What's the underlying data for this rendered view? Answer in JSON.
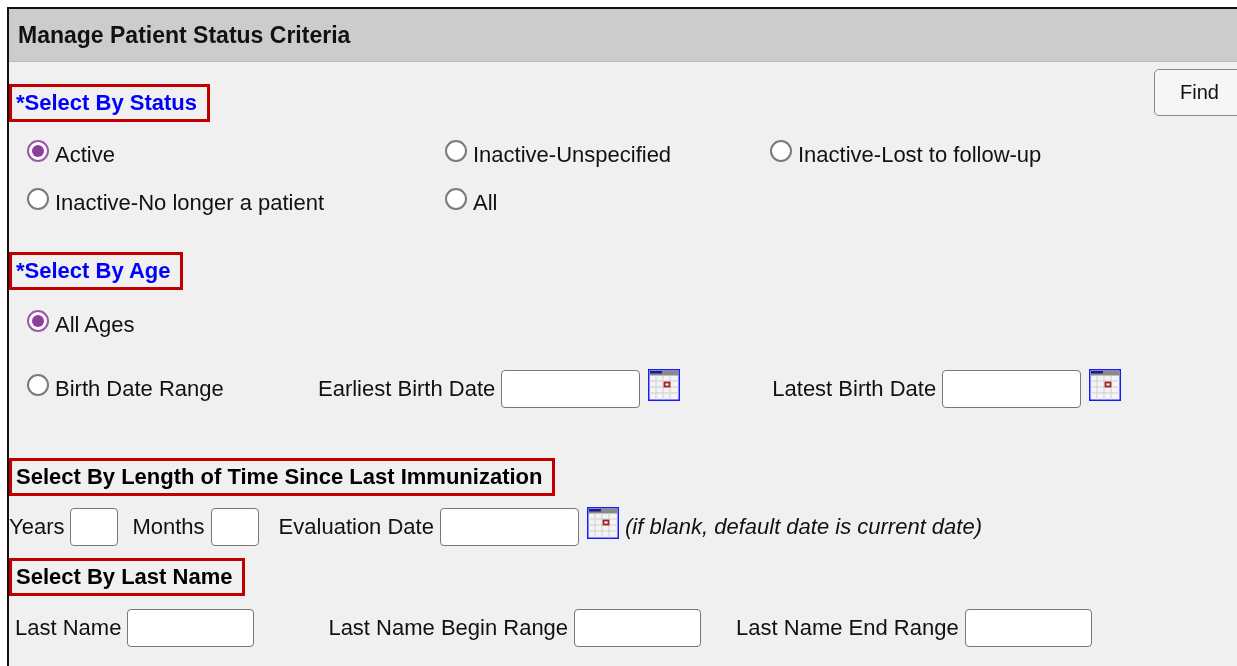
{
  "panel": {
    "title": "Manage Patient Status Criteria",
    "find_button": "Find"
  },
  "status": {
    "heading": "*Select By Status",
    "required": true,
    "highlighted": true,
    "options": [
      {
        "label": "Active",
        "selected": true
      },
      {
        "label": "Inactive-Unspecified",
        "selected": false
      },
      {
        "label": "Inactive-Lost to follow-up",
        "selected": false
      },
      {
        "label": "Inactive-No longer a patient",
        "selected": false
      },
      {
        "label": "All",
        "selected": false
      }
    ]
  },
  "age": {
    "heading": "*Select By Age",
    "required": true,
    "highlighted": true,
    "options": [
      {
        "label": "All Ages",
        "selected": true
      },
      {
        "label": "Birth Date Range",
        "selected": false
      }
    ],
    "fields": [
      {
        "label": "Earliest Birth Date",
        "kind": "date"
      },
      {
        "label": "Latest Birth Date",
        "kind": "date"
      }
    ]
  },
  "last_immunization": {
    "heading": "Select By Length of Time Since Last Immunization",
    "required": false,
    "highlighted": true,
    "fields": [
      {
        "label": "Years",
        "kind": "number"
      },
      {
        "label": "Months",
        "kind": "number"
      },
      {
        "label": "Evaluation Date",
        "kind": "date"
      }
    ],
    "note": "(if blank, default date is current date)"
  },
  "last_name": {
    "heading": "Select By Last Name",
    "required": false,
    "highlighted": true,
    "fields": [
      {
        "label": "Last Name",
        "kind": "text"
      },
      {
        "label": "Last Name Begin Range",
        "kind": "text"
      },
      {
        "label": "Last Name End Range",
        "kind": "text"
      }
    ]
  }
}
